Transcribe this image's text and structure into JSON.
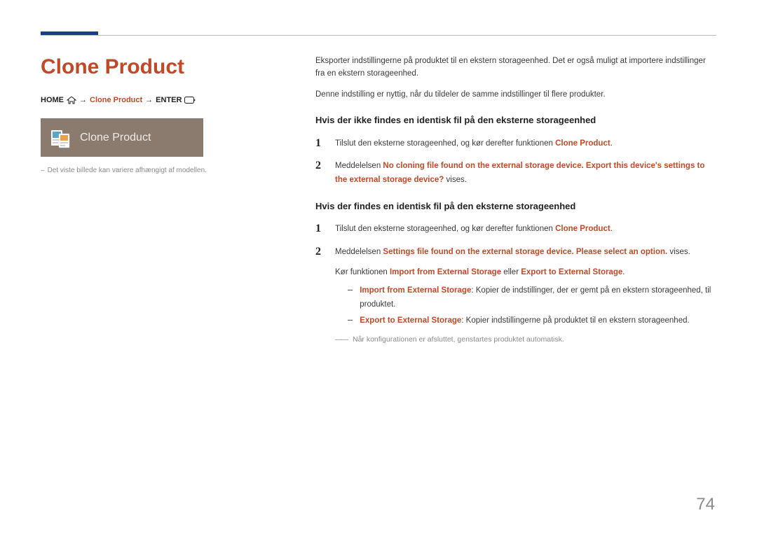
{
  "title": "Clone Product",
  "breadcrumb": {
    "home": "HOME",
    "arrow": "→",
    "mid": "Clone Product",
    "enter": "ENTER"
  },
  "tile_label": "Clone Product",
  "left_note": "Det viste billede kan variere afhængigt af modellen.",
  "intro1": "Eksporter indstillingerne på produktet til en ekstern storageenhed. Det er også muligt at importere indstillinger fra en ekstern storageenhed.",
  "intro2": "Denne indstilling er nyttig, når du tildeler de samme indstillinger til flere produkter.",
  "section1": {
    "heading": "Hvis der ikke findes en identisk fil på den eksterne storageenhed",
    "step1_a": "Tilslut den eksterne storageenhed, og kør derefter funktionen ",
    "step1_b": "Clone Product",
    "step1_c": ".",
    "step2_a": "Meddelelsen ",
    "step2_b": "No cloning file found on the external storage device. Export this device's settings to the external storage device?",
    "step2_c": " vises."
  },
  "section2": {
    "heading": "Hvis der findes en identisk fil på den eksterne storageenhed",
    "step1_a": "Tilslut den eksterne storageenhed, og kør derefter funktionen ",
    "step1_b": "Clone Product",
    "step1_c": ".",
    "step2_a": "Meddelelsen ",
    "step2_b": "Settings file found on the external storage device. Please select an option.",
    "step2_c": " vises.",
    "sub_a": "Kør funktionen ",
    "sub_b": "Import from External Storage",
    "sub_c": " eller ",
    "sub_d": "Export to External Storage",
    "sub_e": ".",
    "b1_a": "Import from External Storage",
    "b1_b": ": Kopier de indstillinger, der er gemt på en ekstern storageenhed, til produktet.",
    "b2_a": "Export to External Storage",
    "b2_b": ": Kopier indstillingerne på produktet til en ekstern storageenhed.",
    "footnote": "Når konfigurationen er afsluttet, genstartes produktet automatisk."
  },
  "page_number": "74"
}
